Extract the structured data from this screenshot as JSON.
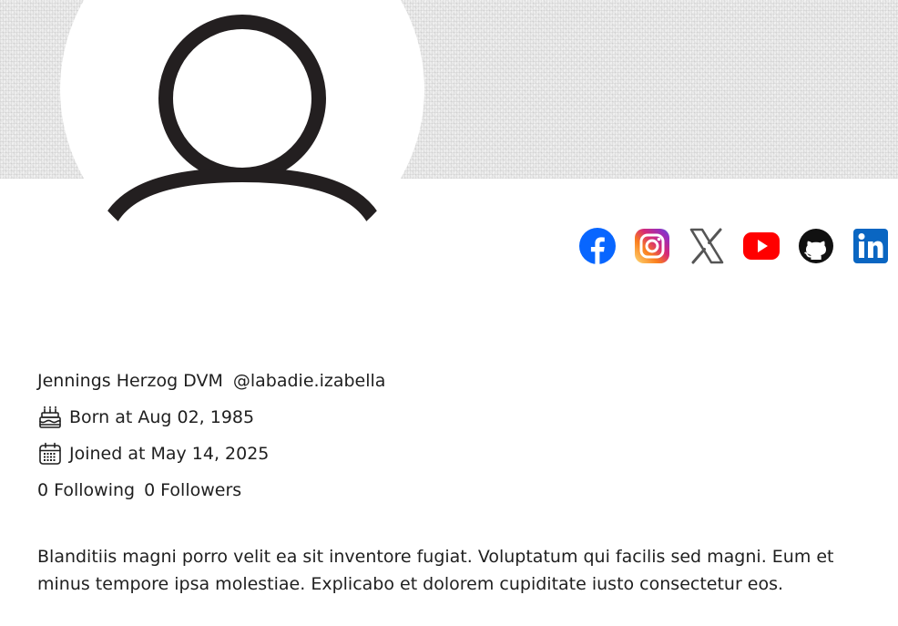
{
  "profile": {
    "name": "Jennings Herzog DVM",
    "handle": "@labadie.izabella",
    "birth_text": "Born at Aug 02, 1985",
    "joined_text": "Joined at May 14, 2025",
    "following_count": "0",
    "following_label": "Following",
    "followers_count": "0",
    "followers_label": "Followers",
    "bio": "Blanditiis magni porro velit ea sit inventore fugiat. Voluptatum qui facilis sed magni. Eum et minus tempore ipsa molestiae. Explicabo et dolorem cupiditate iusto consectetur eos."
  },
  "icons": {
    "avatar": "user-avatar-icon",
    "birthday": "cake-icon",
    "joined": "calendar-icon"
  },
  "socials": [
    {
      "name": "facebook",
      "color": "#0866FF"
    },
    {
      "name": "instagram",
      "color": "#E1306C"
    },
    {
      "name": "x",
      "color": "#555555"
    },
    {
      "name": "youtube",
      "color": "#FF0000"
    },
    {
      "name": "github",
      "color": "#111111"
    },
    {
      "name": "linkedin",
      "color": "#0A66C2"
    }
  ]
}
